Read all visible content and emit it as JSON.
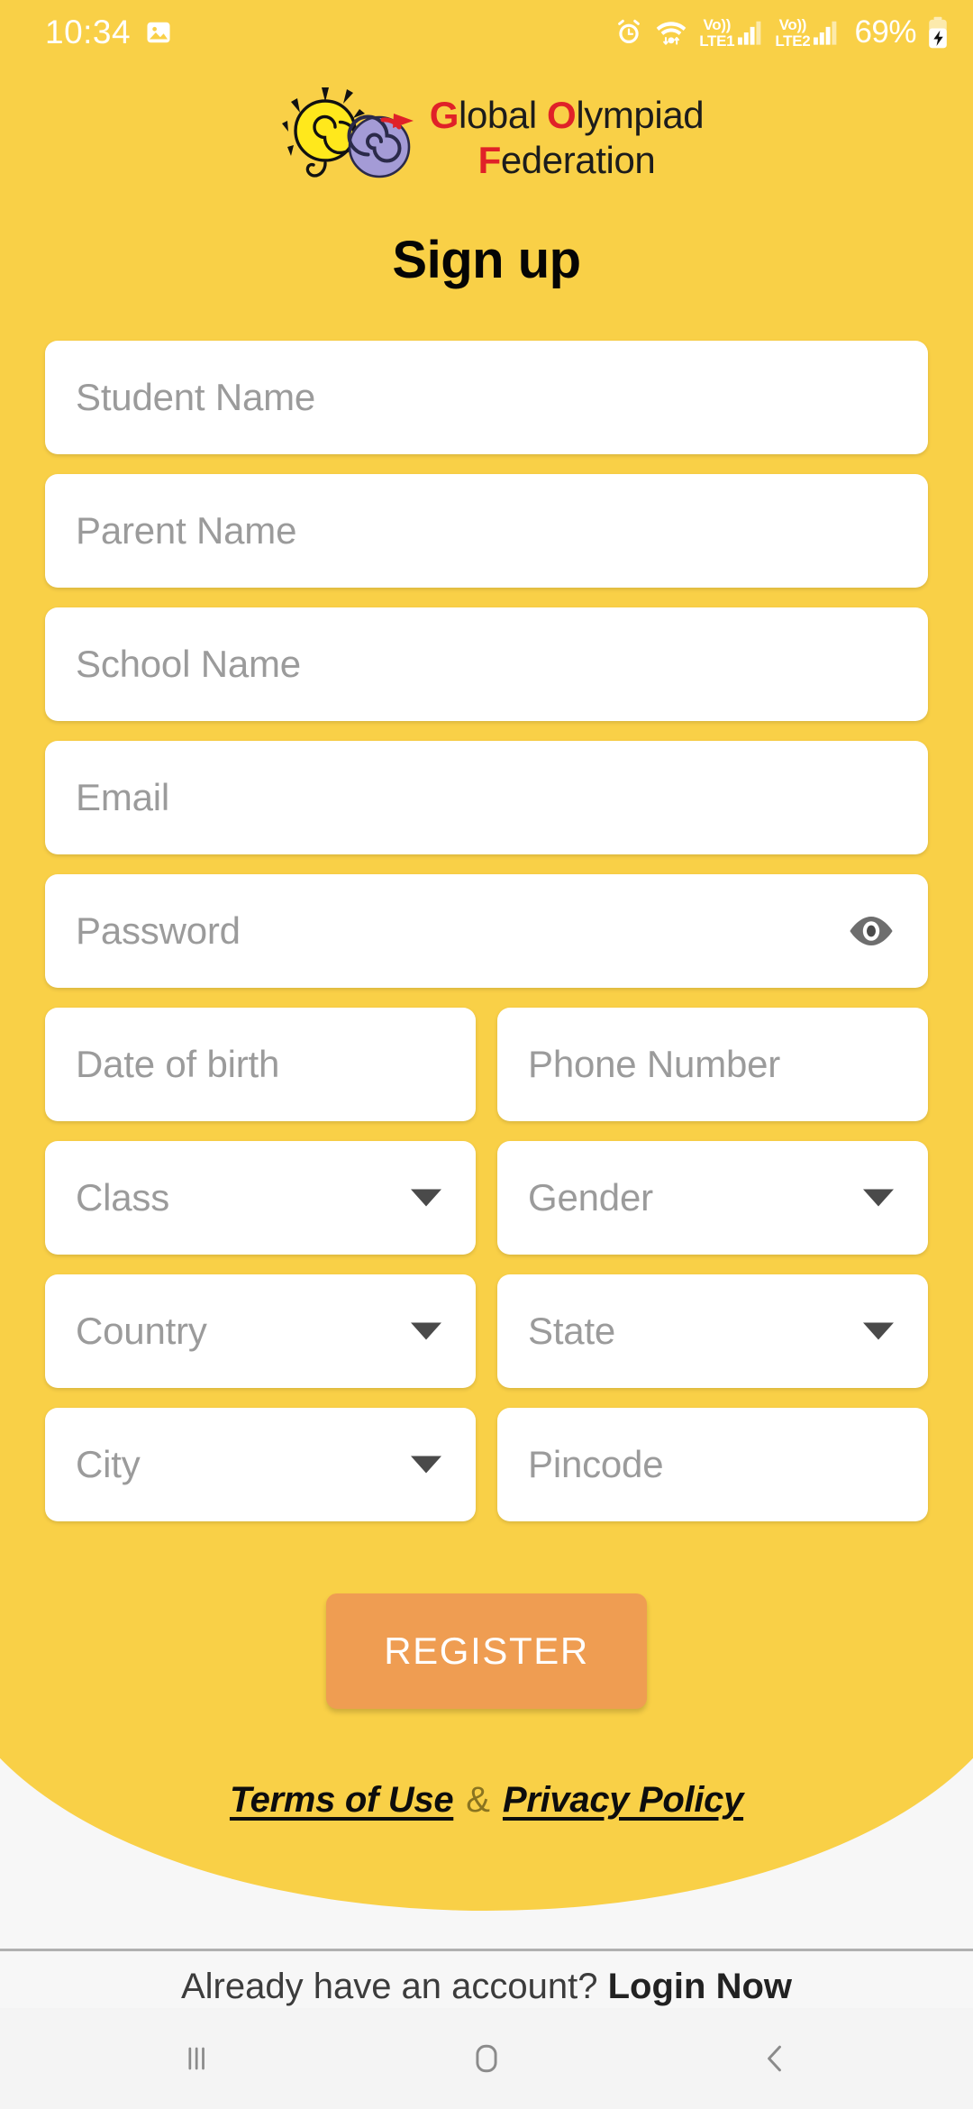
{
  "status_bar": {
    "time": "10:34",
    "icons": [
      "image-icon",
      "alarm-icon",
      "wifi-icon",
      "signal-icon"
    ],
    "network_1": {
      "top": "Vo))",
      "bottom": "LTE1"
    },
    "network_2": {
      "top": "Vo))",
      "bottom": "LTE2"
    },
    "battery_percent": "69%"
  },
  "logo": {
    "line1_accent": "G",
    "line1_rest": "lobal ",
    "line1_accent2": "O",
    "line1_rest2": "lympiad",
    "line2_accent": "F",
    "line2_rest": "ederation",
    "colors": {
      "accent": "#E02128",
      "bulb": "#FFE81C",
      "spiral": "#A49BD6",
      "arrow": "#E02128"
    }
  },
  "page": {
    "title": "Sign up",
    "background_color": "#F9D047"
  },
  "form": {
    "fields": [
      {
        "name": "student-name",
        "placeholder": "Student Name",
        "type": "text",
        "width": "full"
      },
      {
        "name": "parent-name",
        "placeholder": "Parent Name",
        "type": "text",
        "width": "full"
      },
      {
        "name": "school-name",
        "placeholder": "School Name",
        "type": "text",
        "width": "full"
      },
      {
        "name": "email",
        "placeholder": "Email",
        "type": "text",
        "width": "full"
      },
      {
        "name": "password",
        "placeholder": "Password",
        "type": "password",
        "width": "full",
        "trailing_icon": "eye-icon"
      },
      {
        "name": "date-of-birth",
        "placeholder": "Date of birth",
        "type": "text",
        "width": "half"
      },
      {
        "name": "phone-number",
        "placeholder": "Phone Number",
        "type": "text",
        "width": "half"
      },
      {
        "name": "class",
        "placeholder": "Class",
        "type": "dropdown",
        "width": "half"
      },
      {
        "name": "gender",
        "placeholder": "Gender",
        "type": "dropdown",
        "width": "half"
      },
      {
        "name": "country",
        "placeholder": "Country",
        "type": "dropdown",
        "width": "half"
      },
      {
        "name": "state",
        "placeholder": "State",
        "type": "dropdown",
        "width": "half"
      },
      {
        "name": "city",
        "placeholder": "City",
        "type": "dropdown",
        "width": "half"
      },
      {
        "name": "pincode",
        "placeholder": "Pincode",
        "type": "text",
        "width": "half"
      }
    ]
  },
  "register": {
    "label": "REGISTER",
    "color": "#EF9D52"
  },
  "terms": {
    "terms_label": "Terms of Use",
    "separator": "&",
    "privacy_label": "Privacy Policy"
  },
  "login_prompt": {
    "text": "Already have an account? ",
    "link": "Login Now"
  },
  "nav_bar": {
    "recents": "recents-icon",
    "home": "home-icon",
    "back": "back-icon"
  }
}
